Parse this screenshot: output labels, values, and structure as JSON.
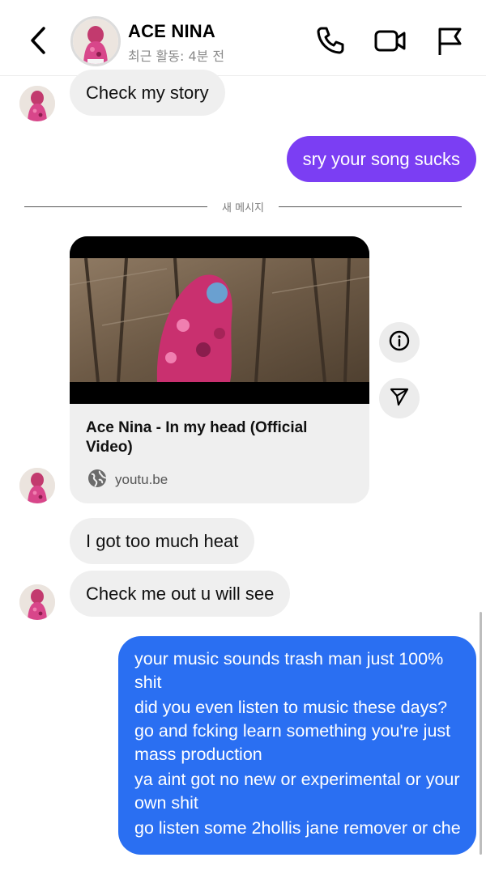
{
  "header": {
    "name": "ACE NINA",
    "status": "최근 활동: 4분 전",
    "icons": [
      "back-chevron-icon",
      "phone-icon",
      "video-camera-icon",
      "flag-icon"
    ]
  },
  "messages": {
    "m1": "Check my story",
    "m2": "sry your song sucks",
    "divider": "새 메시지",
    "link_card": {
      "title": "Ace Nina - In my head (Official Video)",
      "source": "youtu.be"
    },
    "m3": "I got too much heat",
    "m4": "Check me out u will see",
    "m5": [
      "your music sounds trash man just 100% shit",
      "did you even listen to music these days? go and fcking learn something you're just mass production",
      "ya aint got no new or experimental or your own shit",
      "go listen some 2hollis jane remover or che"
    ]
  },
  "colors": {
    "outgoing_purple": "#7b3ef3",
    "outgoing_blue": "#2a6ff2",
    "incoming": "#efefef"
  }
}
